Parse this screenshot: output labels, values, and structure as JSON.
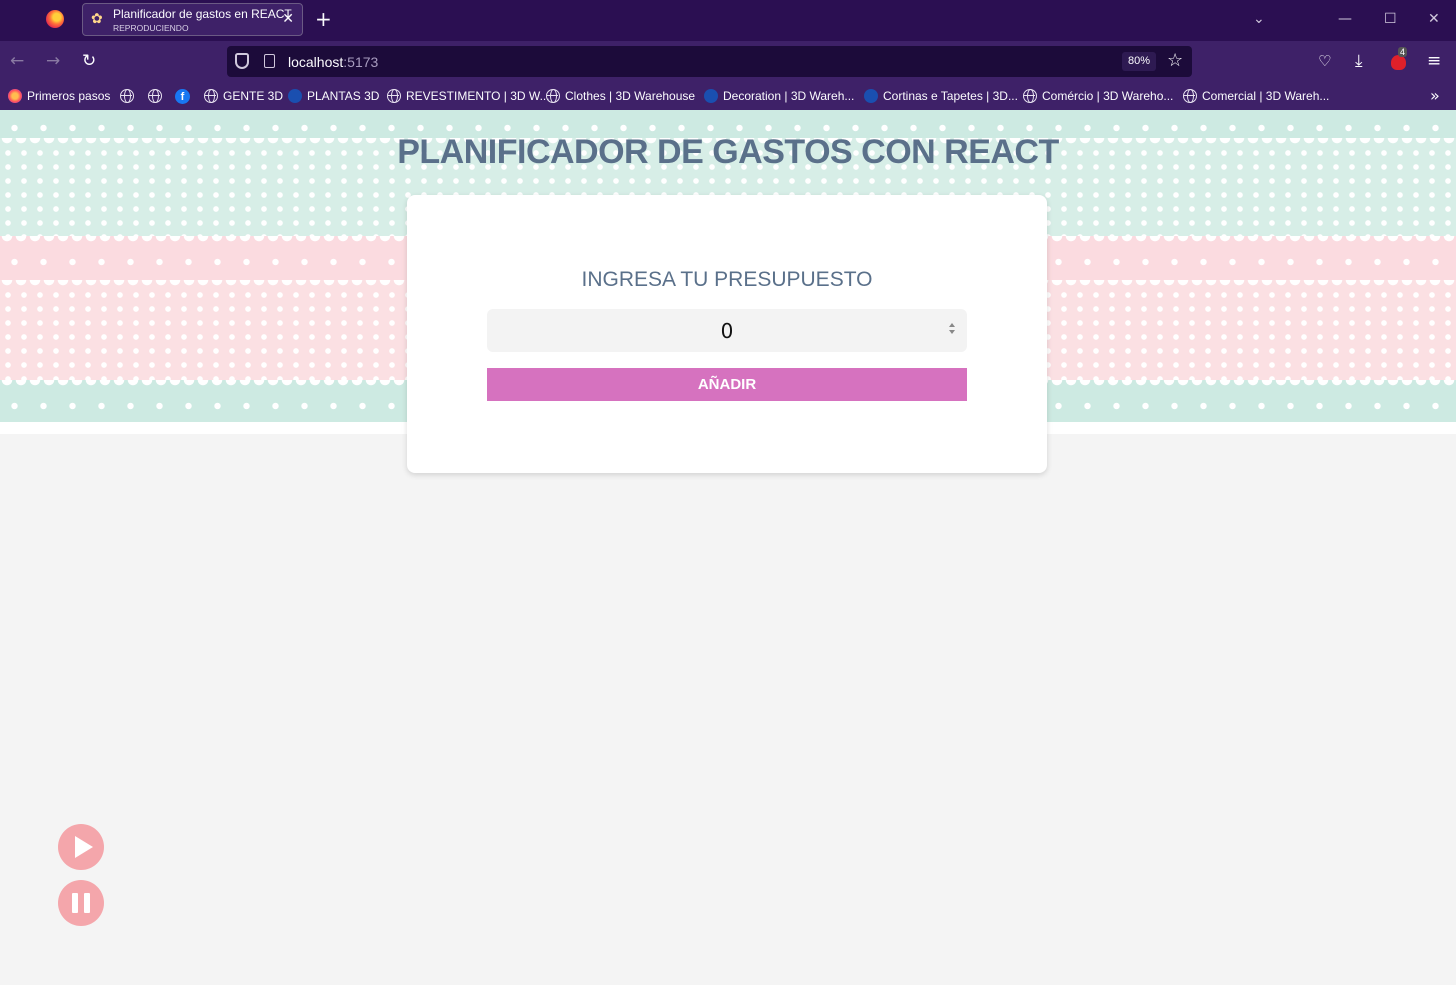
{
  "browser": {
    "tab": {
      "title": "Planificador de gastos en REACT",
      "subtitle": "REPRODUCIENDO"
    },
    "url": {
      "host": "localhost",
      "port": ":5173"
    },
    "zoom": "80%",
    "extension_badge": "4",
    "bookmarks": [
      {
        "label": "Primeros pasos",
        "icon": "firefox-icon"
      },
      {
        "label": "",
        "icon": "globe-icon"
      },
      {
        "label": "",
        "icon": "globe-icon"
      },
      {
        "label": "",
        "icon": "facebook-icon"
      },
      {
        "label": "GENTE 3D",
        "icon": "globe-icon"
      },
      {
        "label": "PLANTAS 3D",
        "icon": "sketchup-icon"
      },
      {
        "label": "REVESTIMENTO | 3D W...",
        "icon": "globe-icon"
      },
      {
        "label": "Clothes | 3D Warehouse",
        "icon": "globe-icon"
      },
      {
        "label": "Decoration | 3D Wareh...",
        "icon": "sketchup-icon"
      },
      {
        "label": "Cortinas e Tapetes | 3D...",
        "icon": "sketchup-icon"
      },
      {
        "label": "Comércio | 3D Wareho...",
        "icon": "globe-icon"
      },
      {
        "label": "Comercial | 3D Wareh...",
        "icon": "globe-icon"
      }
    ]
  },
  "page": {
    "title": "PLANIFICADOR DE GASTOS CON REACT",
    "form": {
      "label": "INGRESA TU PRESUPUESTO",
      "budget_value": "0",
      "submit_label": "AÑADIR"
    },
    "colors": {
      "title": "#5a708a",
      "button": "#d672bf",
      "media": "#f4a6ab",
      "mint": "#d7eee7",
      "pink": "#fbe0e3"
    }
  }
}
